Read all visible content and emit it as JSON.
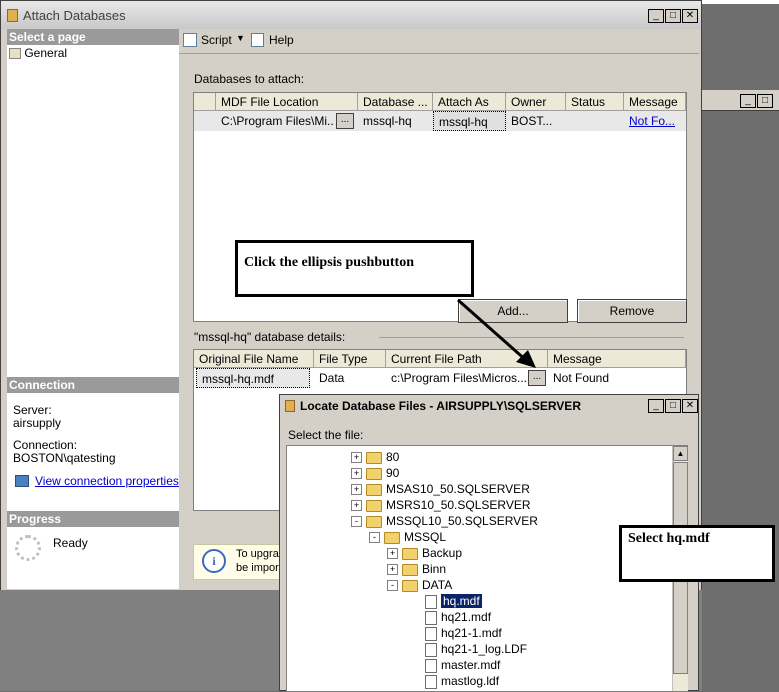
{
  "window": {
    "title": "Attach Databases"
  },
  "left_pane": {
    "select_page": "Select a page",
    "pages": [
      "General"
    ],
    "connection_header": "Connection",
    "server_label": "Server:",
    "server_value": "airsupply",
    "connection_label": "Connection:",
    "connection_value": "BOSTON\\qatesting",
    "view_props_link": "View connection properties",
    "progress_header": "Progress",
    "progress_status": "Ready"
  },
  "toolbar": {
    "script": "Script",
    "help": "Help"
  },
  "attach": {
    "label": "Databases to attach:",
    "columns": [
      "MDF File Location",
      "Database ...",
      "Attach As",
      "Owner",
      "Status",
      "Message"
    ],
    "row": {
      "mdf": "C:\\Program Files\\Mi...",
      "database": "mssql-hq",
      "attach_as": "mssql-hq",
      "owner": "BOST...",
      "status": "",
      "message": "Not Fo..."
    },
    "add_button": "Add...",
    "remove_button": "Remove"
  },
  "details": {
    "label": "\"mssql-hq\" database details:",
    "columns": [
      "Original File Name",
      "File Type",
      "Current File Path",
      "Message"
    ],
    "row": {
      "name": "mssql-hq.mdf",
      "type": "Data",
      "path": "c:\\Program Files\\Micros...",
      "message": "Not Found"
    }
  },
  "info_text": {
    "line1": "To upgra",
    "line2": "be impor"
  },
  "callouts": {
    "ellipsis": "Click the ellipsis pushbutton",
    "select": "Select hq.mdf"
  },
  "dialog": {
    "title": "Locate Database Files - AIRSUPPLY\\SQLSERVER",
    "select_label": "Select the file:",
    "tree": [
      {
        "label": "80",
        "kind": "folder",
        "pm": "+"
      },
      {
        "label": "90",
        "kind": "folder",
        "pm": "+"
      },
      {
        "label": "MSAS10_50.SQLSERVER",
        "kind": "folder",
        "pm": "+"
      },
      {
        "label": "MSRS10_50.SQLSERVER",
        "kind": "folder",
        "pm": "+"
      },
      {
        "label": "MSSQL10_50.SQLSERVER",
        "kind": "folder",
        "pm": "-"
      },
      {
        "label": "MSSQL",
        "kind": "folder",
        "pm": "-"
      },
      {
        "label": "Backup",
        "kind": "folder",
        "pm": "+"
      },
      {
        "label": "Binn",
        "kind": "folder",
        "pm": "+"
      },
      {
        "label": "DATA",
        "kind": "folder",
        "pm": "-"
      },
      {
        "label": "hq.mdf",
        "kind": "file",
        "selected": true
      },
      {
        "label": "hq21.mdf",
        "kind": "file"
      },
      {
        "label": "hq21-1.mdf",
        "kind": "file"
      },
      {
        "label": "hq21-1_log.LDF",
        "kind": "file"
      },
      {
        "label": "master.mdf",
        "kind": "file"
      },
      {
        "label": "mastlog.ldf",
        "kind": "file"
      }
    ]
  }
}
